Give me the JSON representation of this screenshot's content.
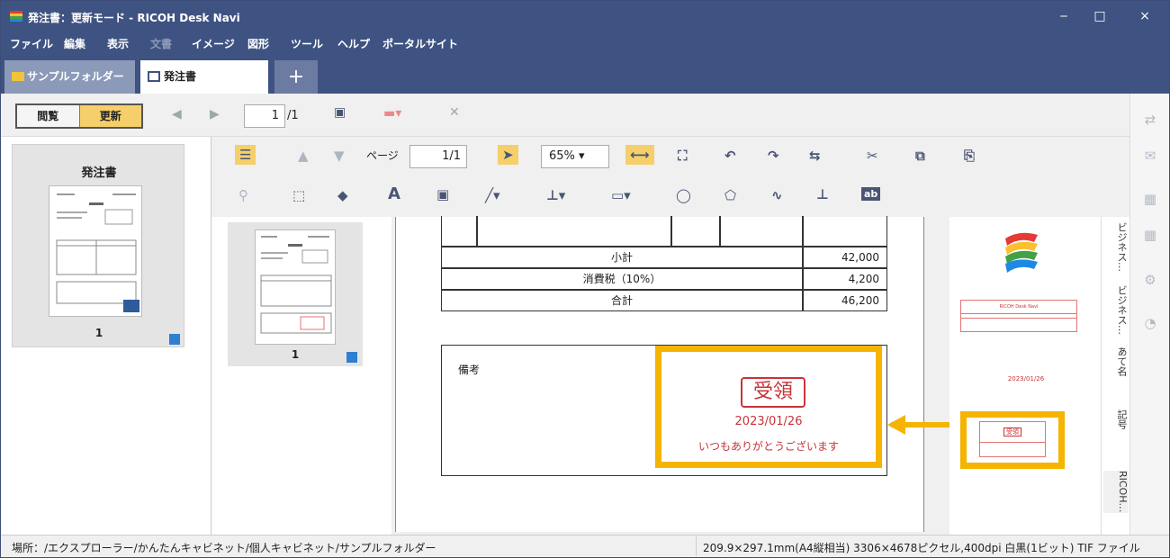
{
  "window": {
    "title": "発注書：更新モード - RICOH Desk Navi",
    "controls": [
      "‒",
      "□",
      "×"
    ]
  },
  "menu": [
    "ファイル",
    "編集",
    "表示",
    "文書",
    "イメージ",
    "図形",
    "ツール",
    "ヘルプ",
    "ポータルサイト"
  ],
  "tabs": [
    {
      "label": "サンプルフォルダー",
      "icon": "folder-icon"
    },
    {
      "label": "発注書",
      "icon": "document-icon"
    },
    {
      "label": "+"
    }
  ],
  "toolbar": {
    "view_label": "閲覧",
    "update_label": "更新",
    "page_current": "1",
    "page_total": "/1"
  },
  "left_thumb": {
    "title": "発注書",
    "page_number": "1"
  },
  "doc_toolbar": {
    "page_label": "ページ",
    "page_current": "1",
    "page_total": "/1",
    "zoom": "65%"
  },
  "thumb2": {
    "page_number": "1"
  },
  "table": {
    "rows": [
      {
        "label": "小計",
        "value": "42,000"
      },
      {
        "label": "消費税（10%）",
        "value": "4,200"
      },
      {
        "label": "合計",
        "value": "46,200"
      }
    ]
  },
  "remarks": {
    "label": "備考"
  },
  "stamp": {
    "text": "受領",
    "date": "2023/01/26",
    "message": "いつもありがとうございます"
  },
  "properties": {
    "tabs": [
      "ビジネス…",
      "ビジネス…",
      "あて名",
      "記号",
      "RICOH…"
    ],
    "card_title": "RICOH Desk Navi",
    "mini_date": "2023/01/26",
    "mini_stamp": "受領"
  },
  "status": {
    "location": "場所：/エクスプローラー/かんたんキャビネット/個人キャビネット/サンプルフォルダー",
    "info": "209.9×297.1mm(A4縦相当) 3306×4678ピクセル,400dpi 白黒(1ビット) TIF ファイル"
  },
  "colors": {
    "titlebar": "#3f5382",
    "accent": "#f5cf6a",
    "highlight": "#f5b400",
    "stamp_red": "#c8333a"
  }
}
